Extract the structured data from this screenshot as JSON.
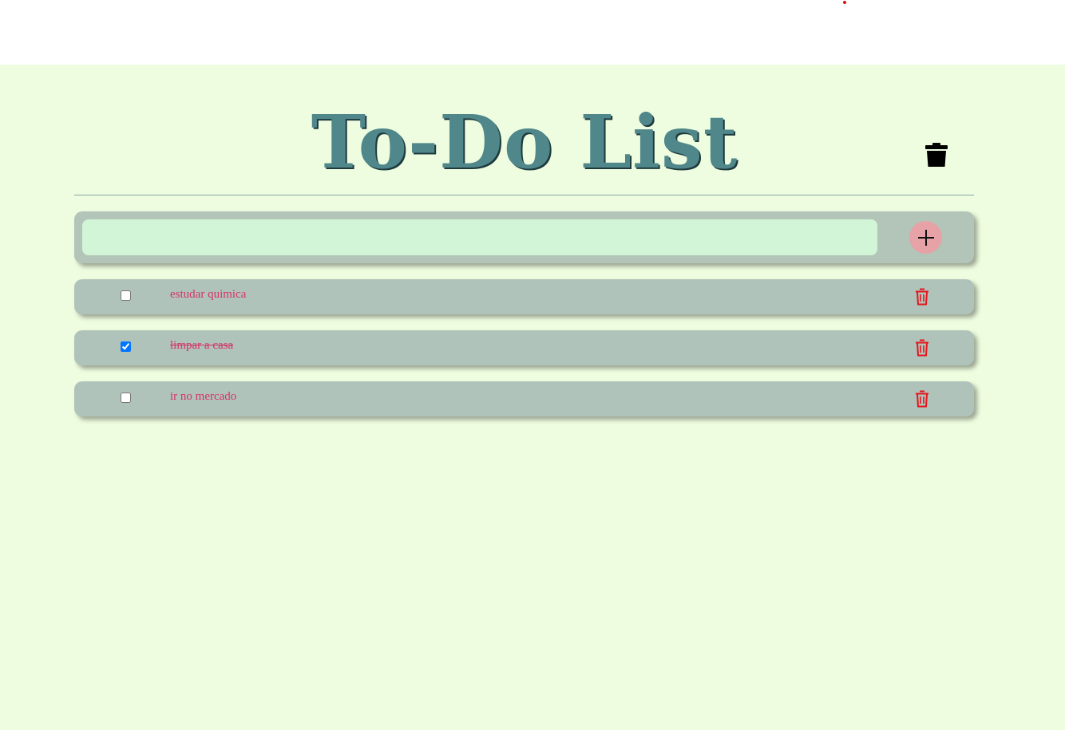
{
  "header": {
    "title": "To-Do List"
  },
  "input": {
    "placeholder": "",
    "value": ""
  },
  "add_button": {
    "icon": "plus-icon"
  },
  "clear_button": {
    "icon": "trash-icon"
  },
  "tasks": [
    {
      "text": "estudar quimica",
      "done": false
    },
    {
      "text": "limpar a casa",
      "done": true
    },
    {
      "text": "ir no mercado",
      "done": false
    }
  ],
  "colors": {
    "background": "#eefddf",
    "title": "#4f878b",
    "task_text": "#d3336a",
    "delete_icon": "#e5161c",
    "add_button": "#e6a2a6"
  }
}
